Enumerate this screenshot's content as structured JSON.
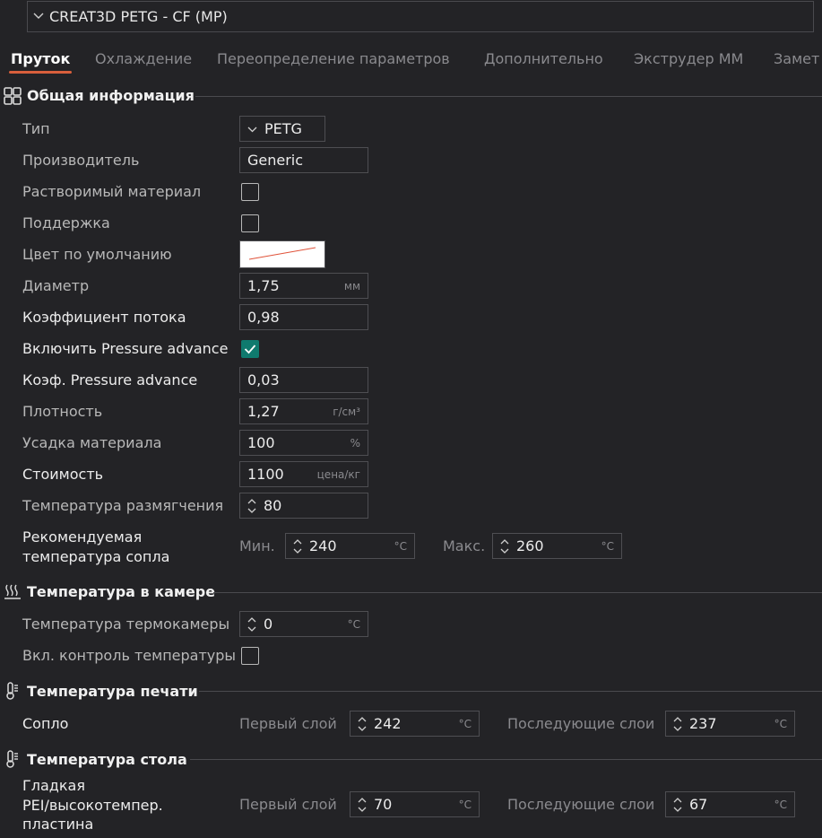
{
  "preset": {
    "name": "CREAT3D PETG - CF (MP)"
  },
  "tabs": [
    {
      "label": "Пруток"
    },
    {
      "label": "Охлаждение"
    },
    {
      "label": "Переопределение параметров"
    },
    {
      "label": "Дополнительно"
    },
    {
      "label": "Экструдер ММ"
    },
    {
      "label": "Замет"
    }
  ],
  "accent_color": "#d85f3c",
  "check_color": "#0f7a6e",
  "general": {
    "title": "Общая информация",
    "icon": "grid-icon",
    "type_label": "Тип",
    "type_value": "PETG",
    "vendor_label": "Производитель",
    "vendor_value": "Generic",
    "soluble_label": "Растворимый материал",
    "soluble_checked": false,
    "support_label": "Поддержка",
    "support_checked": false,
    "color_label": "Цвет по умолчанию",
    "diameter_label": "Диаметр",
    "diameter_value": "1,75",
    "diameter_unit": "мм",
    "flow_label": "Коэффициент потока",
    "flow_value": "0,98",
    "pa_enable_label": "Включить Pressure advance",
    "pa_enable_checked": true,
    "pa_label": "Коэф. Pressure advance",
    "pa_value": "0,03",
    "density_label": "Плотность",
    "density_value": "1,27",
    "density_unit": "г/см³",
    "shrink_label": "Усадка материала",
    "shrink_value": "100",
    "shrink_unit": "%",
    "cost_label": "Стоимость",
    "cost_value": "1100",
    "cost_unit": "цена/кг",
    "soften_label": "Температура размягчения",
    "soften_value": "80",
    "nozzle_rec_label_1": "Рекомендуемая",
    "nozzle_rec_label_2": "температура сопла",
    "min_label": "Мин.",
    "min_value": "240",
    "min_unit": "°C",
    "max_label": "Макс.",
    "max_value": "260",
    "max_unit": "°C"
  },
  "chamber": {
    "title": "Температура в камере",
    "icon": "heat-waves-icon",
    "temp_label": "Температура термокамеры",
    "temp_value": "0",
    "temp_unit": "°C",
    "control_label": "Вкл. контроль температуры",
    "control_checked": false
  },
  "print_temp": {
    "title": "Температура печати",
    "icon": "thermometer-icon",
    "nozzle_label": "Сопло",
    "first_label": "Первый слой",
    "first_value": "242",
    "first_unit": "°C",
    "other_label": "Последующие слои",
    "other_value": "237",
    "other_unit": "°C"
  },
  "bed_temp": {
    "title": "Температура стола",
    "icon": "thermometer-icon",
    "plate_label_1": "Гладкая",
    "plate_label_2": "PEI/высокотемпер.",
    "plate_label_3": "пластина",
    "first_label": "Первый слой",
    "first_value": "70",
    "first_unit": "°C",
    "other_label": "Последующие слои",
    "other_value": "67",
    "other_unit": "°C"
  }
}
